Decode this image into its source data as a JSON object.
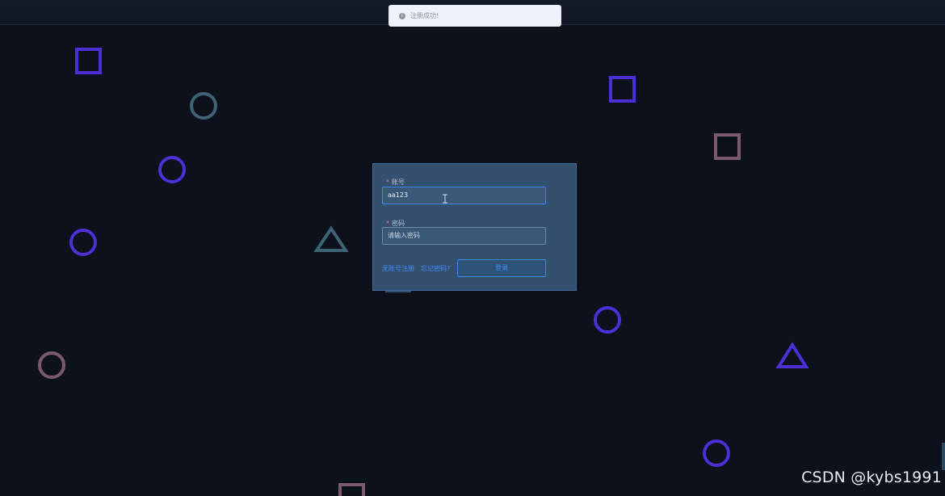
{
  "toast": {
    "message": "注册成功!"
  },
  "form": {
    "account_label": "账号",
    "account_value": "aa123",
    "password_label": "密码",
    "password_placeholder": "请输入密码",
    "register_link": "无账号注册",
    "forgot_link": "忘记密码?",
    "login_button": "登录"
  },
  "watermark": "CSDN @kybs1991",
  "colors": {
    "background": "#0c111b",
    "card": "#33506f",
    "accent": "#3f8cff",
    "shape_purple": "#4a30d6",
    "shape_teal": "#3d6374",
    "shape_mauve": "#7b5a70"
  }
}
